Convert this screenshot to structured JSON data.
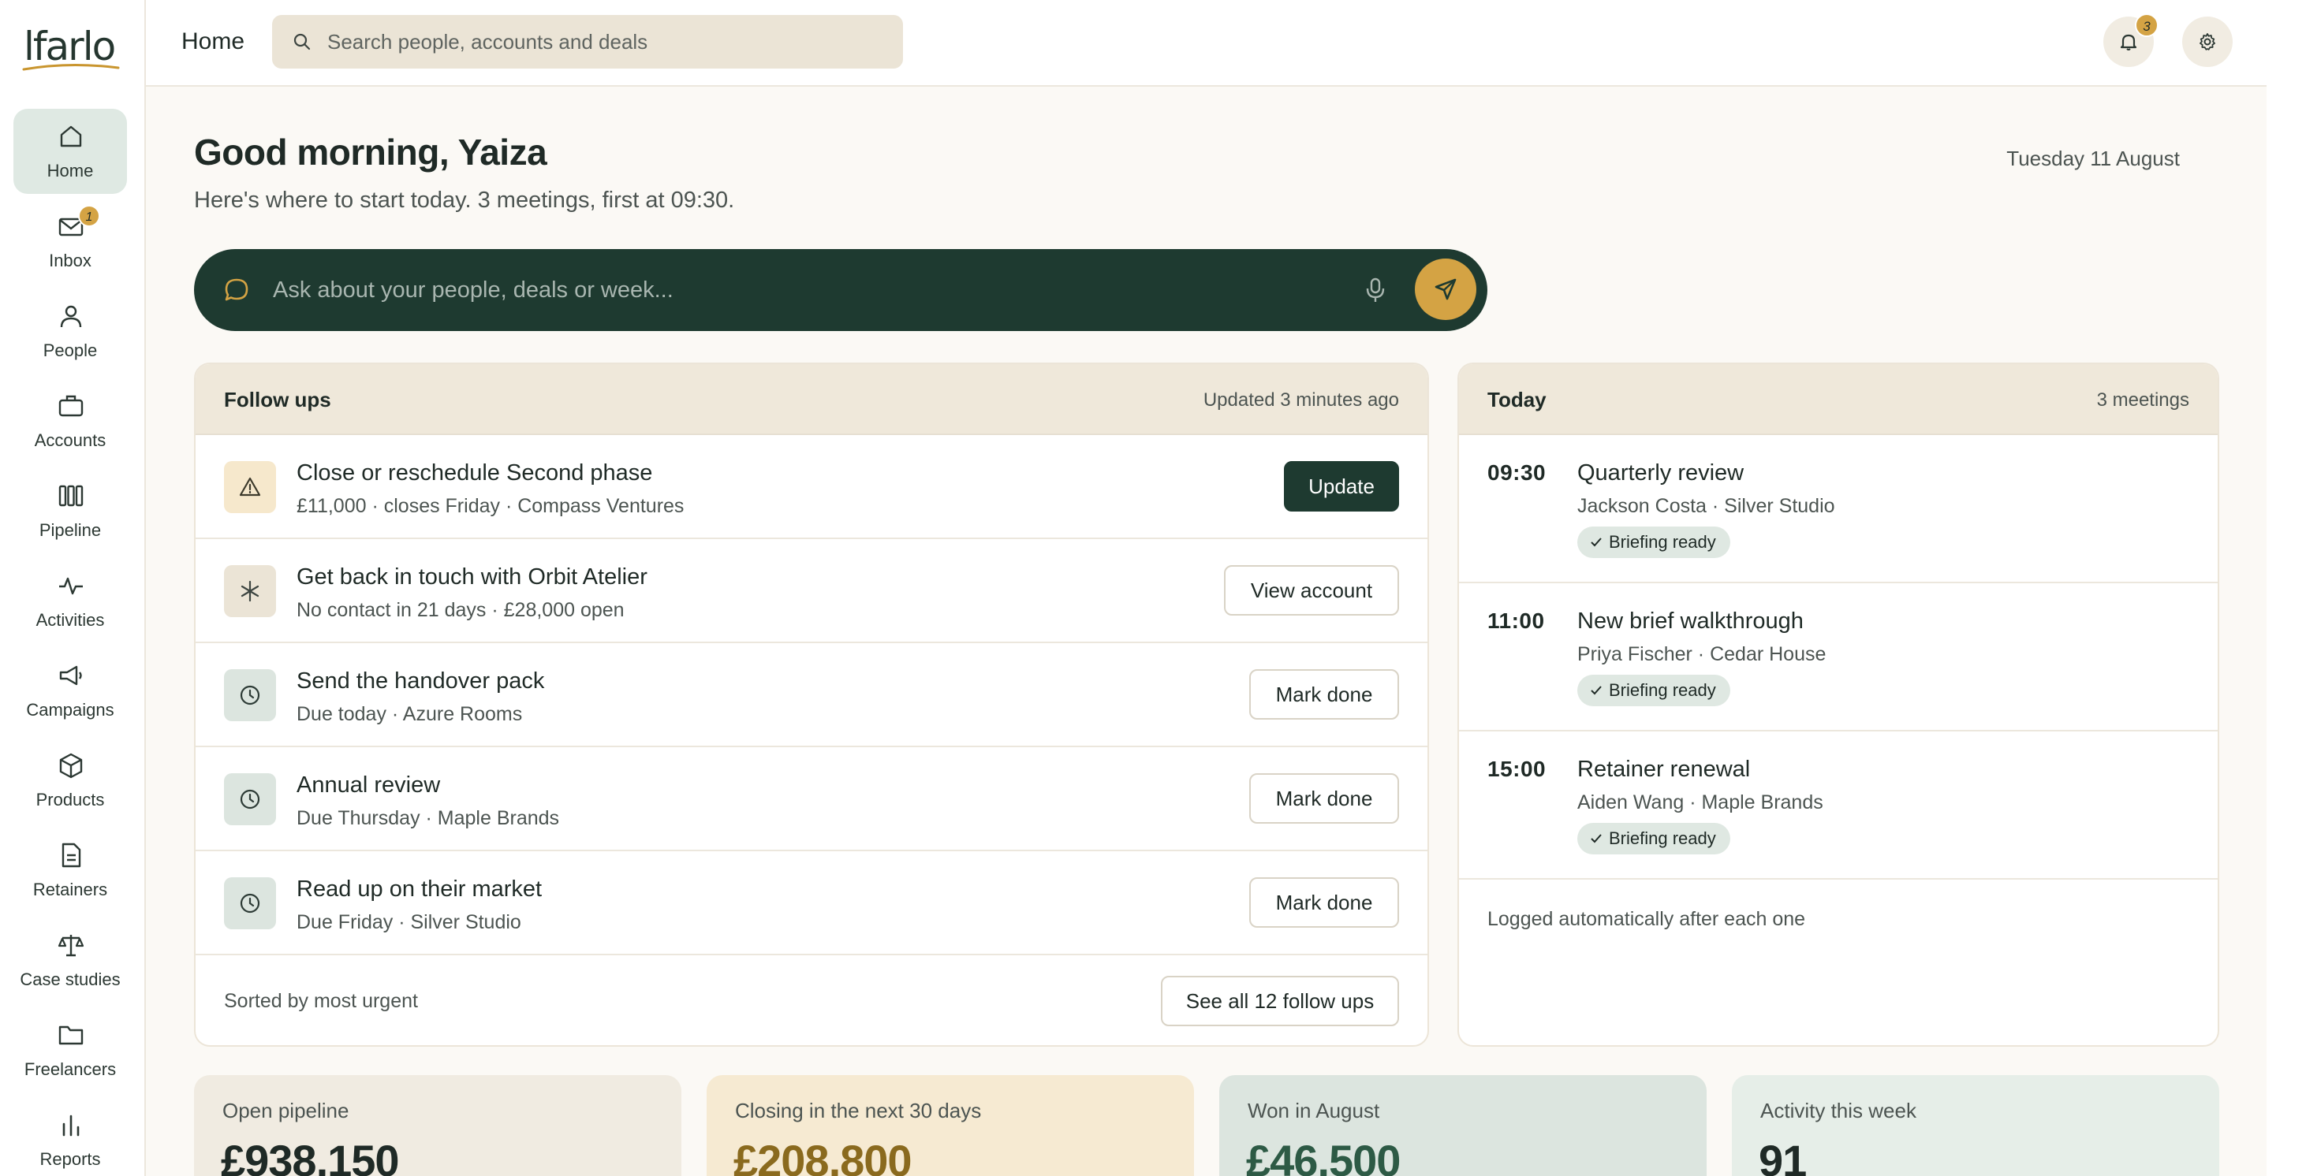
{
  "brand": {
    "name": "lfarlo"
  },
  "sidebar": {
    "items": [
      {
        "label": "Home",
        "icon": "home-icon",
        "active": true
      },
      {
        "label": "Inbox",
        "icon": "inbox-icon",
        "badge": "1"
      },
      {
        "label": "People",
        "icon": "person-icon"
      },
      {
        "label": "Accounts",
        "icon": "briefcase-icon"
      },
      {
        "label": "Pipeline",
        "icon": "columns-icon"
      },
      {
        "label": "Activities",
        "icon": "pulse-icon"
      },
      {
        "label": "Campaigns",
        "icon": "megaphone-icon"
      },
      {
        "label": "Products",
        "icon": "box-icon"
      },
      {
        "label": "Retainers",
        "icon": "document-icon"
      },
      {
        "label": "Case studies",
        "icon": "scale-icon"
      },
      {
        "label": "Freelancers",
        "icon": "folder-icon"
      },
      {
        "label": "Reports",
        "icon": "bar-chart-icon"
      }
    ]
  },
  "topbar": {
    "title": "Home",
    "search_placeholder": "Search people, accounts and deals",
    "notifications_badge": "3"
  },
  "greeting": {
    "title": "Good morning, Yaiza",
    "subtitle": "Here's where to start today. 3 meetings, first at 09:30.",
    "date": "Tuesday 11 August"
  },
  "ask": {
    "placeholder": "Ask about your people, deals or week..."
  },
  "followups": {
    "title": "Follow ups",
    "updated": "Updated 3 minutes ago",
    "items": [
      {
        "title": "Close or reschedule Second phase",
        "sub": "£11,000 · closes Friday · Compass Ventures",
        "action": "Update",
        "icon": "warning-icon"
      },
      {
        "title": "Get back in touch with Orbit Atelier",
        "sub": "No contact in 21 days · £28,000 open",
        "action": "View account",
        "icon": "asterisk-icon"
      },
      {
        "title": "Send the handover pack",
        "sub": "Due today · Azure Rooms",
        "action": "Mark done",
        "icon": "clock-icon"
      },
      {
        "title": "Annual review",
        "sub": "Due Thursday · Maple Brands",
        "action": "Mark done",
        "icon": "clock-icon"
      },
      {
        "title": "Read up on their market",
        "sub": "Due Friday · Silver Studio",
        "action": "Mark done",
        "icon": "clock-icon"
      }
    ],
    "footer_note": "Sorted by most urgent",
    "see_all": "See all 12 follow ups"
  },
  "today": {
    "title": "Today",
    "meta": "3 meetings",
    "meetings": [
      {
        "time": "09:30",
        "title": "Quarterly review",
        "sub": "Jackson Costa · Silver Studio",
        "status": "Briefing ready"
      },
      {
        "time": "11:00",
        "title": "New brief walkthrough",
        "sub": "Priya Fischer · Cedar House",
        "status": "Briefing ready"
      },
      {
        "time": "15:00",
        "title": "Retainer renewal",
        "sub": "Aiden Wang · Maple Brands",
        "status": "Briefing ready"
      }
    ],
    "note": "Logged automatically after each one"
  },
  "stats": [
    {
      "label": "Open pipeline",
      "value": "£938,150",
      "bg": "#f0ebe1",
      "color": "#1f2a26"
    },
    {
      "label": "Closing in the next 30 days",
      "value": "£208,800",
      "bg": "#f6ead2",
      "color": "#8a6a1e"
    },
    {
      "label": "Won in August",
      "value": "£46,500",
      "bg": "#dce5df",
      "color": "#2d5a45"
    },
    {
      "label": "Activity this week",
      "value": "91",
      "bg": "#e6eee8",
      "color": "#1f2a26"
    }
  ],
  "colors": {
    "accent": "#1e3a30",
    "gold": "#d4a344",
    "background": "#fbf9f5"
  }
}
